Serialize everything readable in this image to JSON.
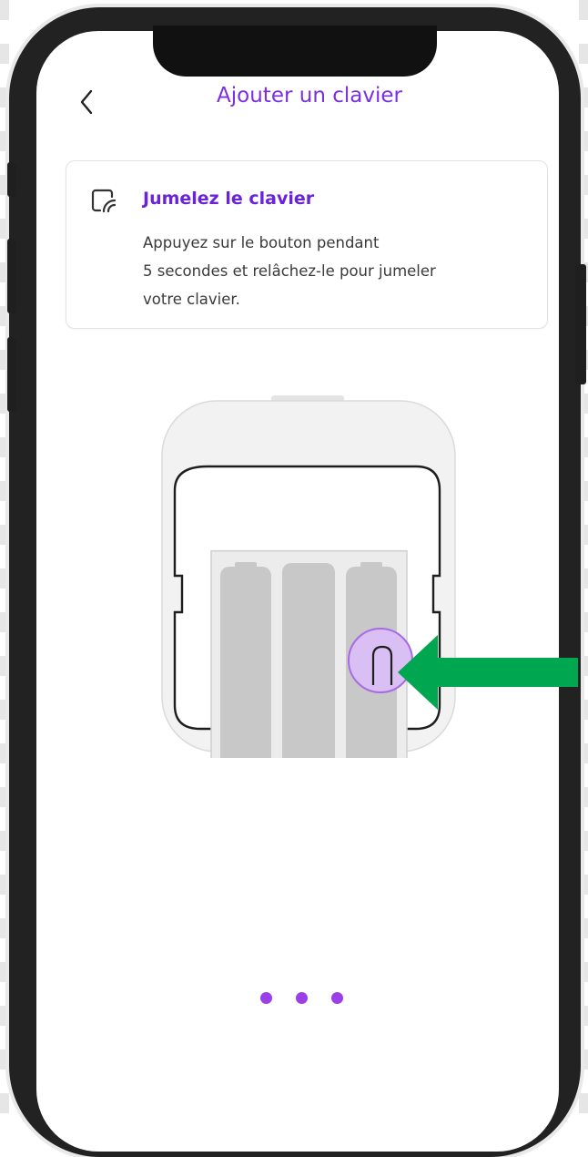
{
  "header": {
    "title": "Ajouter un clavier",
    "back_icon": "chevron-left-icon"
  },
  "card": {
    "icon": "pairing-icon",
    "title": "Jumelez le clavier",
    "lines": [
      "Appuyez sur le bouton pendant",
      "5 secondes et relâchez-le pour jumeler",
      "votre clavier."
    ]
  },
  "illustration": {
    "highlight_button_icon": "pairing-button-icon",
    "arrow_icon": "arrow-left-icon"
  },
  "pagination": {
    "count": 3
  },
  "colors": {
    "accent": "#7c2fe2",
    "dot": "#9b3fe8",
    "arrow": "#00a650",
    "highlight": "#d9bff3"
  }
}
